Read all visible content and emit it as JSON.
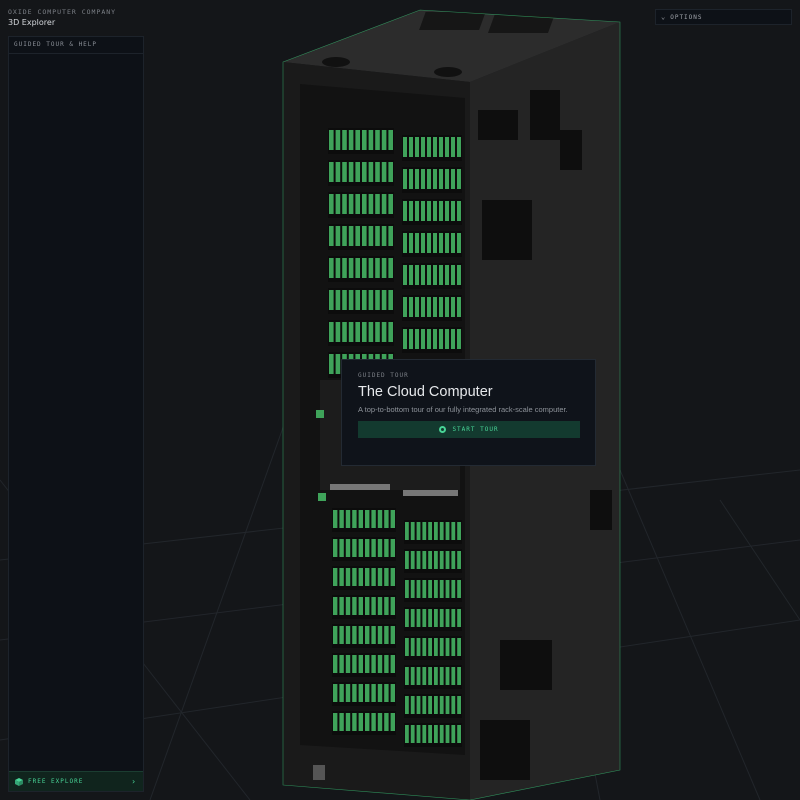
{
  "header": {
    "company": "OXIDE COMPUTER COMPANY",
    "product": "3D Explorer"
  },
  "left_panel": {
    "title": "GUIDED TOUR & HELP",
    "free_explore_label": "FREE EXPLORE",
    "free_explore_icon": "cube-icon",
    "chevron_icon": "chevron-right-icon"
  },
  "options": {
    "label": "OPTIONS",
    "icon": "chevron-down-icon"
  },
  "tour_card": {
    "kicker": "GUIDED TOUR",
    "title": "The Cloud Computer",
    "description": "A top-to-bottom tour of our fully integrated rack-scale computer.",
    "button_label": "START TOUR",
    "button_icon": "compass-icon"
  },
  "colors": {
    "background": "#141619",
    "panel": "#0d1117",
    "accent": "#48d597",
    "accent_dark": "#133a2f",
    "rack_body": "#1e1e1e",
    "sled_green": "#3fa35a",
    "outline": "#3ddc84"
  }
}
